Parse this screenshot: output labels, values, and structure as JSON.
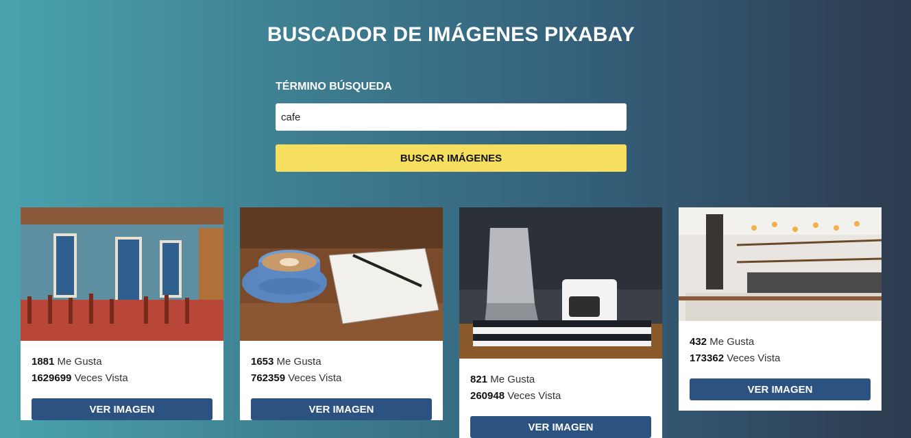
{
  "header": {
    "title": "BUSCADOR DE IMÁGENES PIXABAY"
  },
  "search": {
    "label": "TÉRMINO BÚSQUEDA",
    "value": "cafe",
    "button_label": "BUSCAR IMÁGENES"
  },
  "results": [
    {
      "likes": "1881",
      "likes_label": " Me Gusta",
      "views": "1629699",
      "views_label": " Veces Vista",
      "button_label": "VER IMAGEN",
      "image": "cafe-street-terrace"
    },
    {
      "likes": "1653",
      "likes_label": " Me Gusta",
      "views": "762359",
      "views_label": " Veces Vista",
      "button_label": "VER IMAGEN",
      "image": "coffee-cup-notebook"
    },
    {
      "likes": "821",
      "likes_label": " Me Gusta",
      "views": "260948",
      "views_label": " Veces Vista",
      "button_label": "VER IMAGEN",
      "image": "moka-pot-coffee-mug"
    },
    {
      "likes": "432",
      "likes_label": " Me Gusta",
      "views": "173362",
      "views_label": " Veces Vista",
      "button_label": "VER IMAGEN",
      "image": "coffee-shop-interior"
    }
  ],
  "colors": {
    "accent_button": "#f6df5e",
    "card_button": "#2c5282"
  }
}
